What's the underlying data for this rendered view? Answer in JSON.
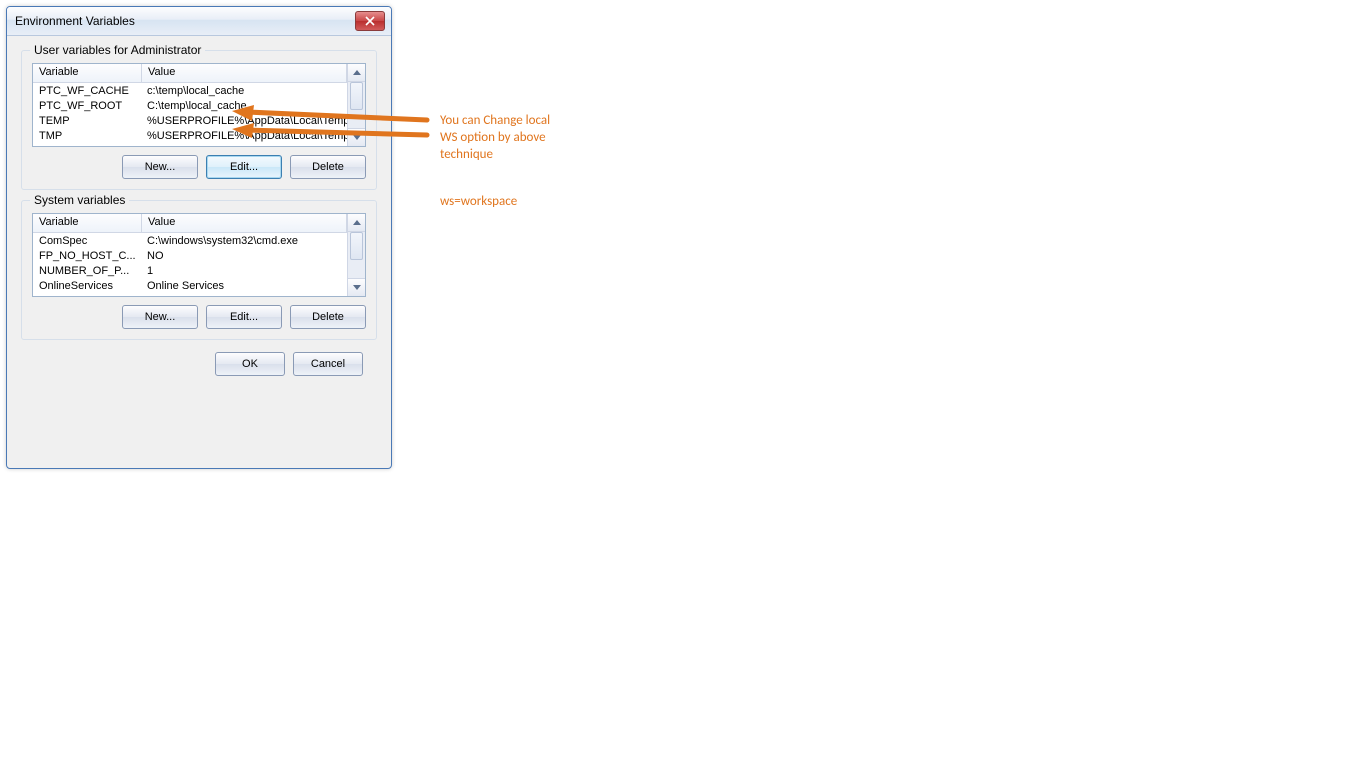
{
  "dialog": {
    "title": "Environment Variables",
    "closeIcon": "close"
  },
  "userVars": {
    "groupLabel": "User variables for Administrator",
    "columns": {
      "variable": "Variable",
      "value": "Value"
    },
    "rows": [
      {
        "variable": "PTC_WF_CACHE",
        "value": "c:\\temp\\local_cache"
      },
      {
        "variable": "PTC_WF_ROOT",
        "value": "C:\\temp\\local_cache"
      },
      {
        "variable": "TEMP",
        "value": "%USERPROFILE%\\AppData\\Local\\Temp"
      },
      {
        "variable": "TMP",
        "value": "%USERPROFILE%\\AppData\\Local\\Temp"
      }
    ],
    "buttons": {
      "new": "New...",
      "edit": "Edit...",
      "delete": "Delete"
    }
  },
  "sysVars": {
    "groupLabel": "System variables",
    "columns": {
      "variable": "Variable",
      "value": "Value"
    },
    "rows": [
      {
        "variable": "ComSpec",
        "value": "C:\\windows\\system32\\cmd.exe"
      },
      {
        "variable": "FP_NO_HOST_C...",
        "value": "NO"
      },
      {
        "variable": "NUMBER_OF_P...",
        "value": "1"
      },
      {
        "variable": "OnlineServices",
        "value": "Online Services"
      }
    ],
    "buttons": {
      "new": "New...",
      "edit": "Edit...",
      "delete": "Delete"
    }
  },
  "dialogButtons": {
    "ok": "OK",
    "cancel": "Cancel"
  },
  "annotations": {
    "line1": "You can Change local",
    "line2": "WS option by above",
    "line3": "technique",
    "line4": "ws=workspace"
  }
}
